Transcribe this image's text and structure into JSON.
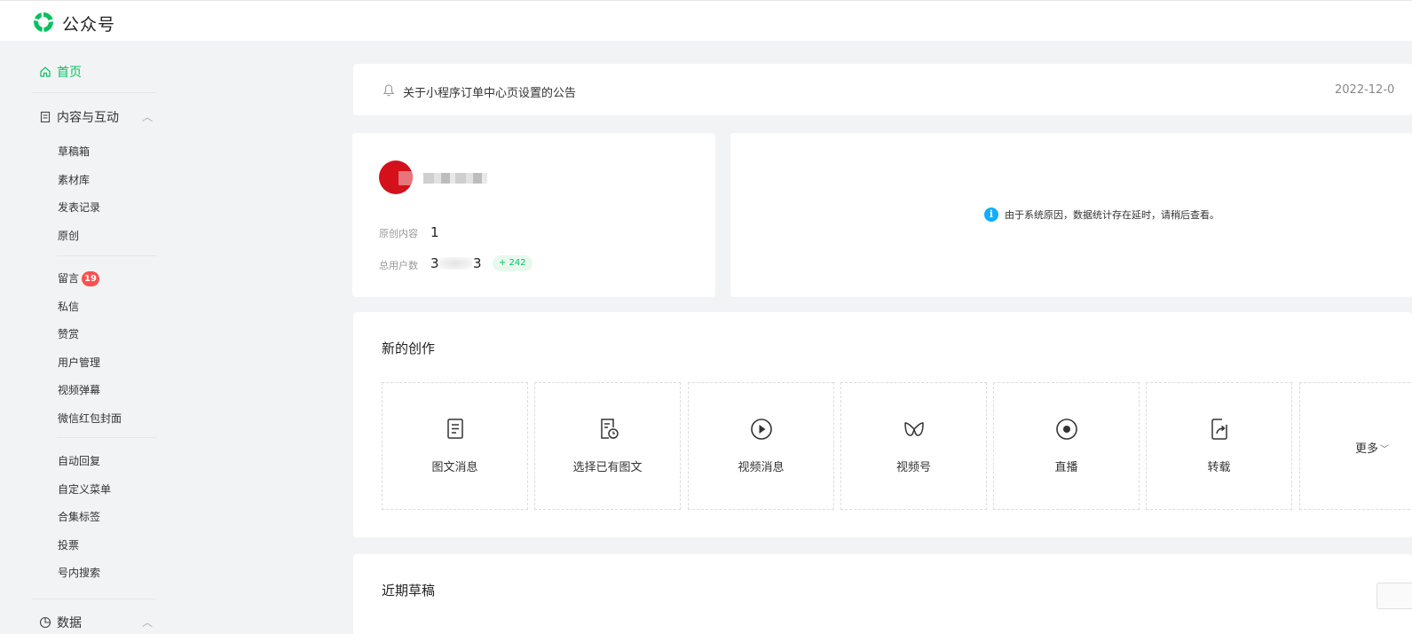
{
  "header": {
    "brand": "公众号"
  },
  "sidebar": {
    "home": "首页",
    "content_group": "内容与互动",
    "content_items": [
      "草稿箱",
      "素材库",
      "发表记录",
      "原创"
    ],
    "interaction_items": [
      "留言",
      "私信",
      "赞赏",
      "用户管理",
      "视频弹幕",
      "微信红包封面"
    ],
    "comment_badge": "19",
    "feature_items": [
      "自动回复",
      "自定义菜单",
      "合集标签",
      "投票",
      "号内搜索"
    ],
    "data_group": "数据"
  },
  "notice": {
    "title": "关于小程序订单中心页设置的公告",
    "date": "2022-12-0"
  },
  "account": {
    "original_label": "原创内容",
    "original_value": "1",
    "users_label": "总用户数",
    "users_prefix": "3",
    "users_suffix": "3",
    "users_delta": "+ 242"
  },
  "stats": {
    "info": "由于系统原因，数据统计存在延时，请稍后查看。"
  },
  "create": {
    "title": "新的创作",
    "tiles": [
      "图文消息",
      "选择已有图文",
      "视频消息",
      "视频号",
      "直播",
      "转载"
    ],
    "more": "更多"
  },
  "drafts": {
    "title": "近期草稿"
  },
  "colors": {
    "accent": "#07c160",
    "badge": "#fa5151",
    "info": "#10aeff"
  }
}
